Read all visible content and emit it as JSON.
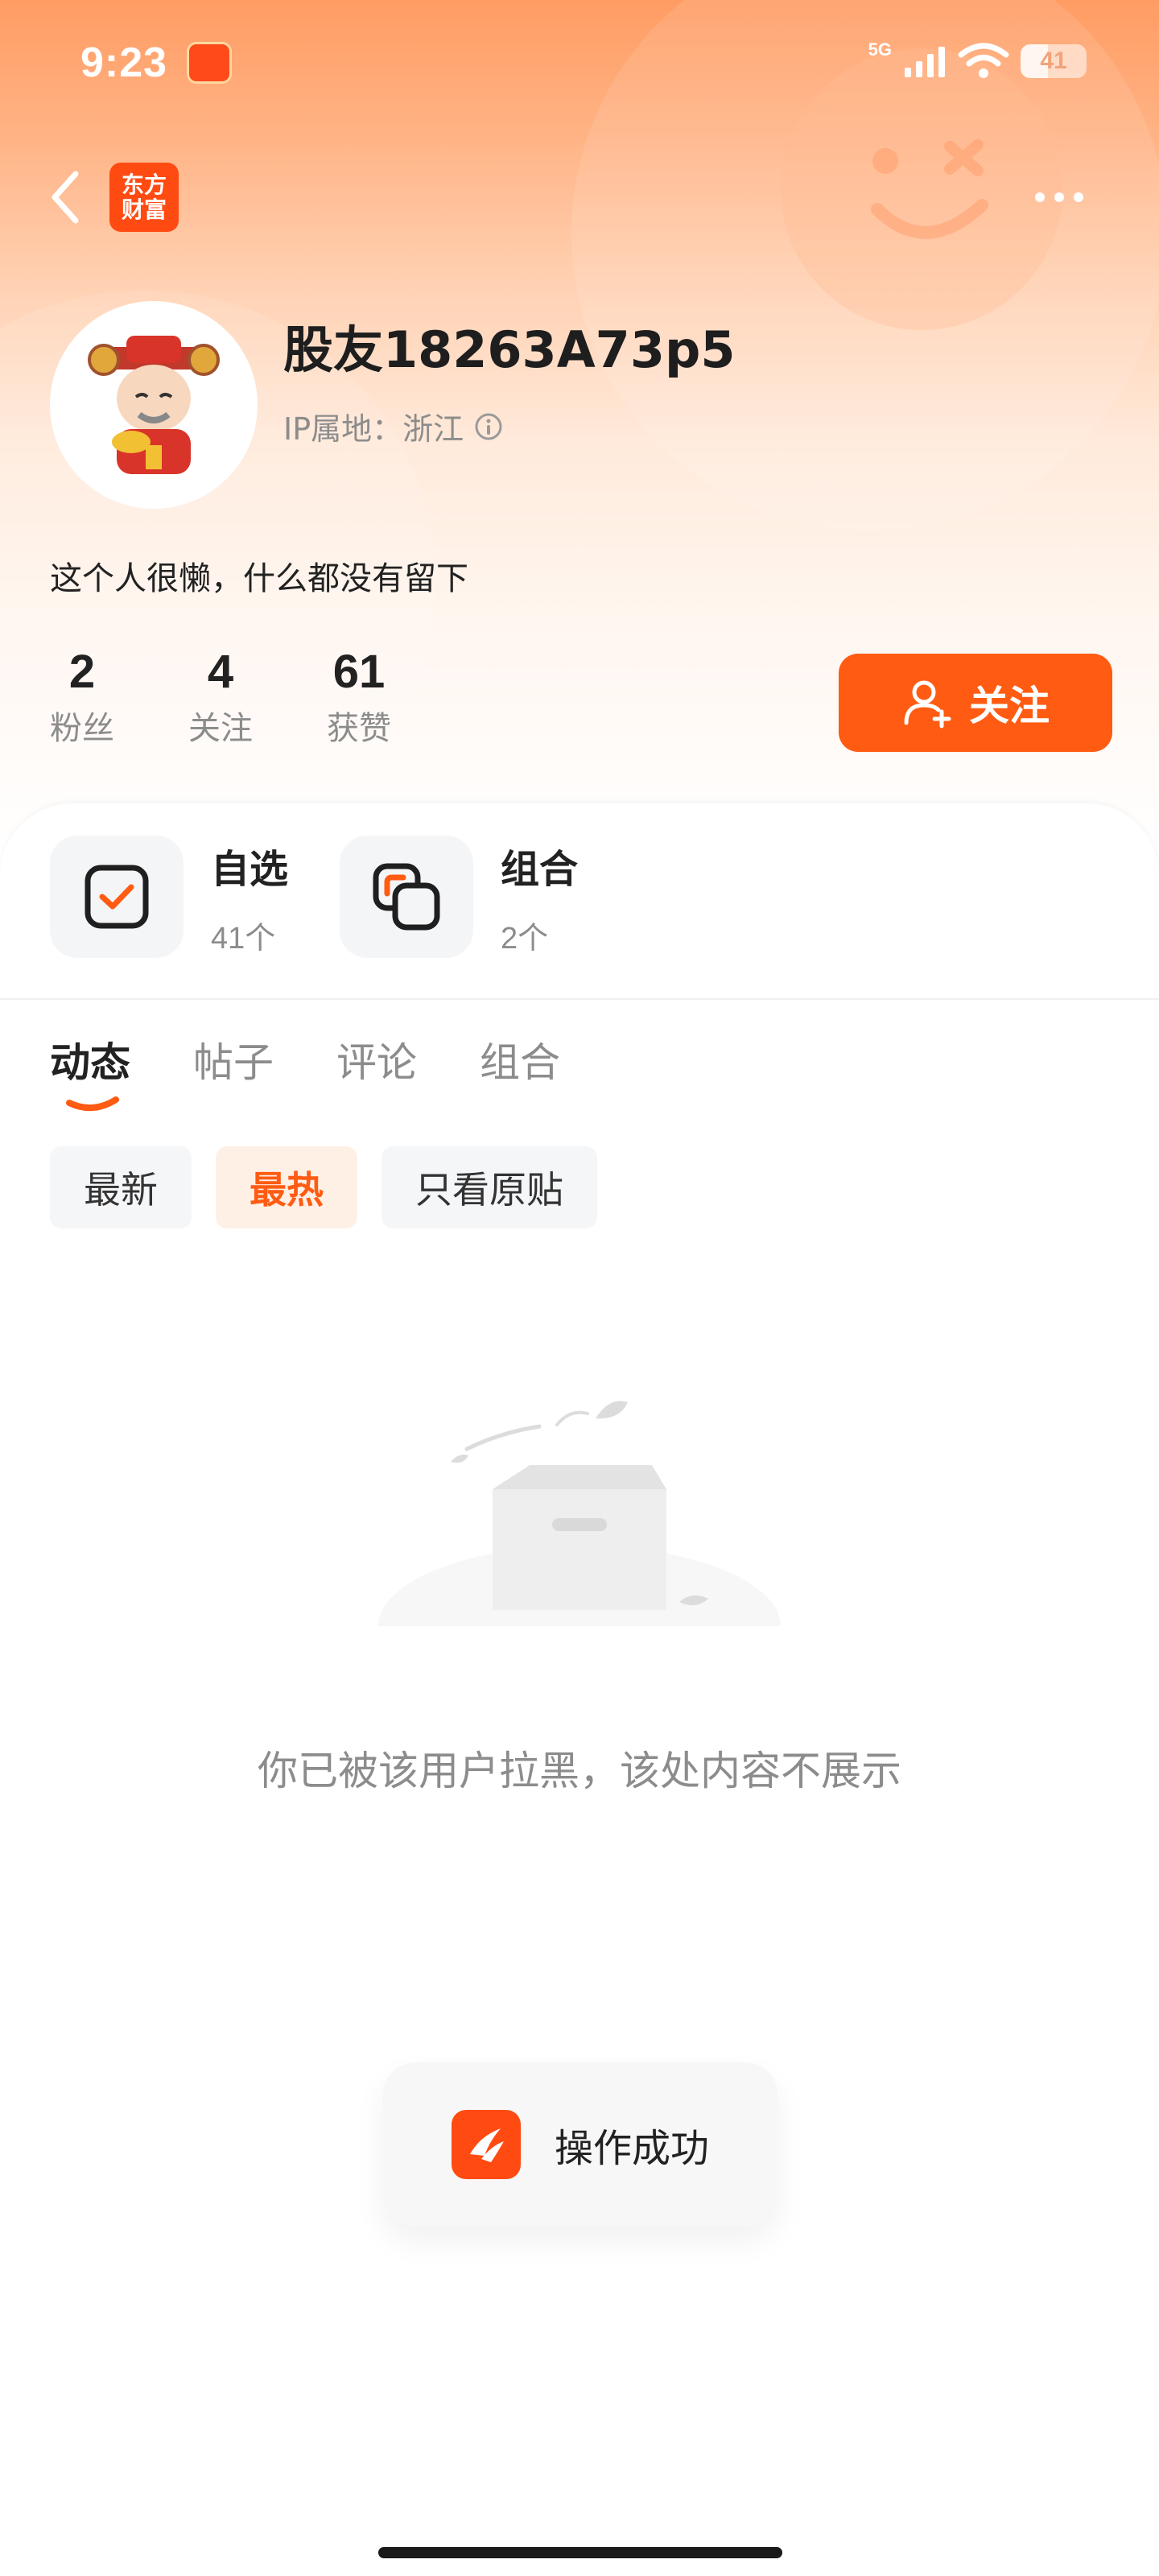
{
  "status_bar": {
    "time": "9:23",
    "network": "5G",
    "battery": "41",
    "battery_level": 0.41
  },
  "header": {
    "brand_line1": "东方",
    "brand_line2": "财富"
  },
  "profile": {
    "username": "股友18263A73p5",
    "ip_location": "IP属地：浙江",
    "bio": "这个人很懒，什么都没有留下"
  },
  "stats": [
    {
      "value": "2",
      "label": "粉丝"
    },
    {
      "value": "4",
      "label": "关注"
    },
    {
      "value": "61",
      "label": "获赞"
    }
  ],
  "follow_button": {
    "label": "关注"
  },
  "shortcuts": [
    {
      "title": "自选",
      "count": "41个"
    },
    {
      "title": "组合",
      "count": "2个"
    }
  ],
  "tabs": [
    "动态",
    "帖子",
    "评论",
    "组合"
  ],
  "filters": [
    "最新",
    "最热",
    "只看原贴"
  ],
  "empty_message": "你已被该用户拉黑，该处内容不展示",
  "toast": {
    "message": "操作成功"
  },
  "colors": {
    "accent": "#ff5b12",
    "brand": "#ff4a12"
  }
}
